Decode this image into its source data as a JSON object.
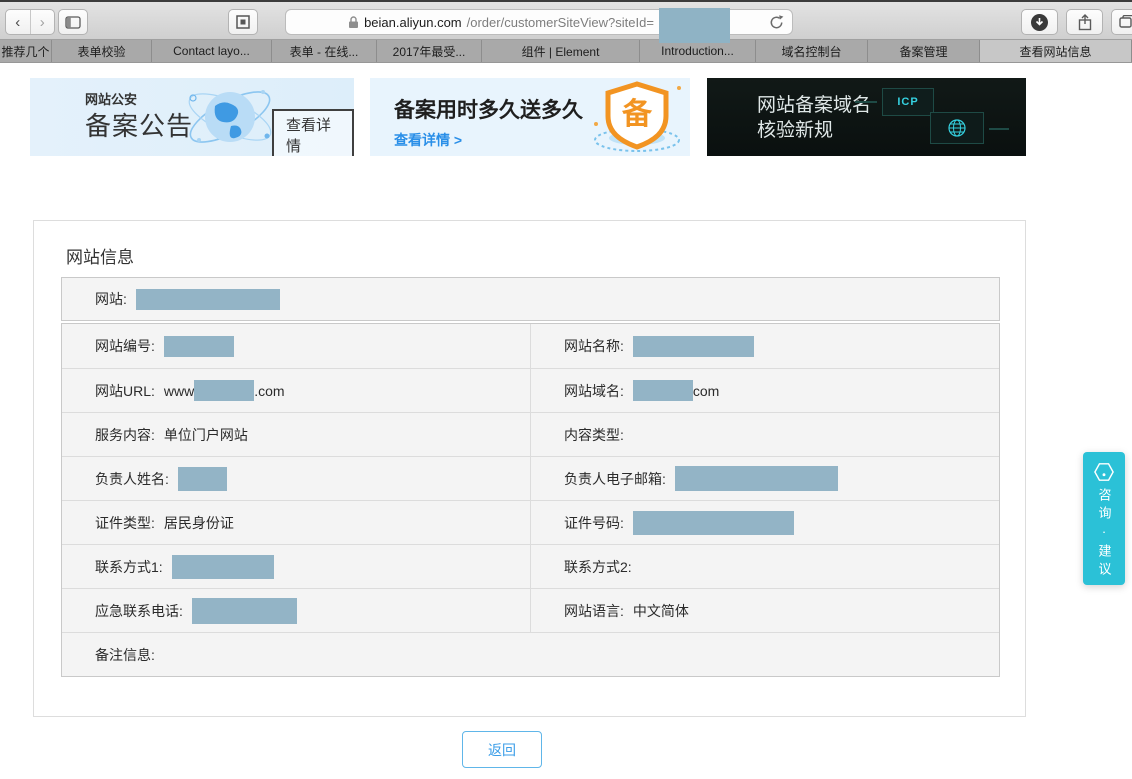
{
  "browser": {
    "url_domain": "beian.aliyun.com",
    "url_path": "/order/customerSiteView?siteId=",
    "tabs": [
      "推荐几个",
      "表单校验",
      "Contact layo...",
      "表单 - 在线...",
      "2017年最受...",
      "组件 | Element",
      "Introduction...",
      "域名控制台",
      "备案管理",
      "查看网站信息"
    ]
  },
  "banners": {
    "police": {
      "tag": "网站公安",
      "title": "备案公告",
      "button": "查看详情"
    },
    "promo": {
      "title": "备案用时多久送多久",
      "link": "查看详情 >",
      "badge_char": "备"
    },
    "dark": {
      "line1": "网站备案域名",
      "line2": "核验新规",
      "badge1": "ICP"
    }
  },
  "card": {
    "title": "网站信息",
    "header_row": {
      "label": "网站:"
    },
    "rows": [
      {
        "left": {
          "label": "网站编号:"
        },
        "right": {
          "label": "网站名称:"
        }
      },
      {
        "left": {
          "label": "网站URL:",
          "prefix": "www",
          "suffix": ".com"
        },
        "right": {
          "label": "网站域名:",
          "suffix": "com"
        }
      },
      {
        "left": {
          "label": "服务内容:",
          "value": "单位门户网站"
        },
        "right": {
          "label": "内容类型:"
        }
      },
      {
        "left": {
          "label": "负责人姓名:"
        },
        "right": {
          "label": "负责人电子邮箱:"
        }
      },
      {
        "left": {
          "label": "证件类型:",
          "value": "居民身份证"
        },
        "right": {
          "label": "证件号码:"
        }
      },
      {
        "left": {
          "label": "联系方式1:"
        },
        "right": {
          "label": "联系方式2:"
        }
      },
      {
        "left": {
          "label": "应急联系电话:"
        },
        "right": {
          "label": "网站语言:",
          "value": "中文简体"
        }
      }
    ],
    "footer_row": {
      "label": "备注信息:"
    }
  },
  "back_button": "返回",
  "consult_widget": {
    "text": "咨询·建议"
  }
}
